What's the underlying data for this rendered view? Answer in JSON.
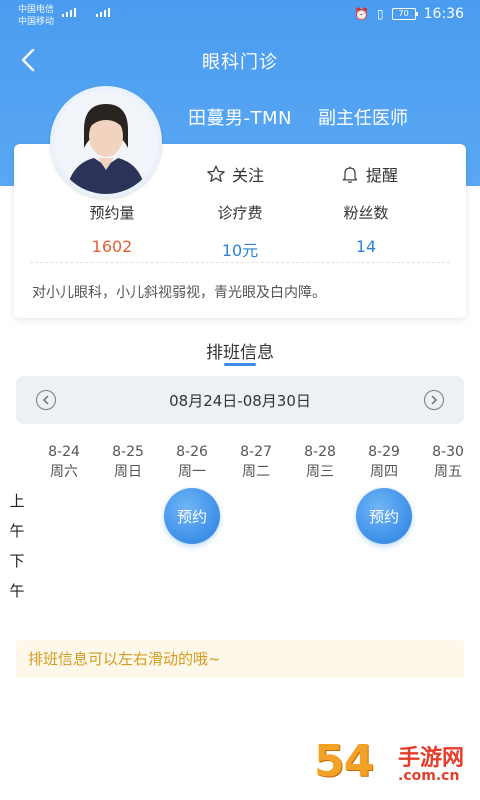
{
  "status_bar": {
    "carrier1": "中国电信",
    "carrier2": "中国移动",
    "net1": "4G",
    "net2": "2G",
    "battery": "70",
    "time": "16:36"
  },
  "nav": {
    "title": "眼科门诊",
    "back_icon": "chevron-left-icon"
  },
  "doctor": {
    "name": "田蔓男-TMN",
    "title": "副主任医师",
    "follow_label": "关注",
    "remind_label": "提醒",
    "stats": [
      {
        "label": "预约量",
        "value": "1602",
        "color": "#e4603a"
      },
      {
        "label": "诊疗费",
        "value": "10元",
        "color": "#2c83d8"
      },
      {
        "label": "粉丝数",
        "value": "14",
        "color": "#2c83d8"
      }
    ],
    "description": "对小儿眼科，小儿斜视弱视，青光眼及白内障。"
  },
  "schedule": {
    "section_title": "排班信息",
    "week_range": "08月24日-08月30日",
    "days": [
      {
        "date": "8-24",
        "weekday": "周六"
      },
      {
        "date": "8-25",
        "weekday": "周日"
      },
      {
        "date": "8-26",
        "weekday": "周一"
      },
      {
        "date": "8-27",
        "weekday": "周二"
      },
      {
        "date": "8-28",
        "weekday": "周三"
      },
      {
        "date": "8-29",
        "weekday": "周四"
      },
      {
        "date": "8-30",
        "weekday": "周五"
      }
    ],
    "am_label": [
      "上",
      "午"
    ],
    "pm_label": [
      "下",
      "午"
    ],
    "book_label": "预约",
    "bookings": [
      {
        "day": "8-26",
        "period": "上午"
      },
      {
        "day": "8-29",
        "period": "上午"
      }
    ],
    "hint": "排班信息可以左右滑动的哦~"
  },
  "watermark": {
    "number": "54",
    "cn": "手游网",
    "url": ".com.cn"
  },
  "colors": {
    "header": "#4a9cf0",
    "accent": "#3a8ee6",
    "hint_bg": "#fdf8ea",
    "hint_text": "#d49b1f"
  }
}
